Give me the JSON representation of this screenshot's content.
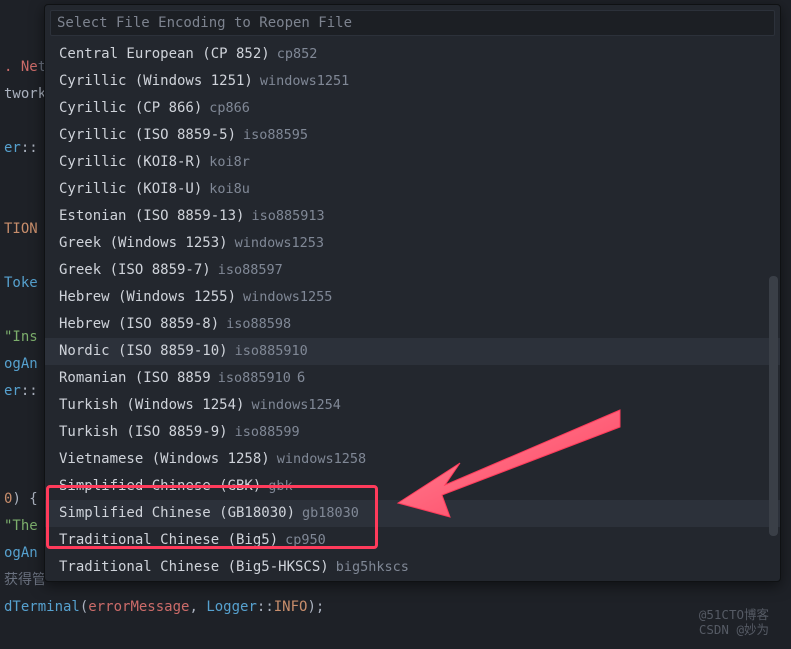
{
  "search": {
    "placeholder": "Select File Encoding to Reopen File"
  },
  "items": [
    {
      "label": "Central European (CP 852)",
      "desc": "cp852",
      "hl": false
    },
    {
      "label": "Cyrillic (Windows 1251)",
      "desc": "windows1251",
      "hl": false
    },
    {
      "label": "Cyrillic (CP 866)",
      "desc": "cp866",
      "hl": false
    },
    {
      "label": "Cyrillic (ISO 8859-5)",
      "desc": "iso88595",
      "hl": false
    },
    {
      "label": "Cyrillic (KOI8-R)",
      "desc": "koi8r",
      "hl": false
    },
    {
      "label": "Cyrillic (KOI8-U)",
      "desc": "koi8u",
      "hl": false
    },
    {
      "label": "Estonian (ISO 8859-13)",
      "desc": "iso885913",
      "hl": false
    },
    {
      "label": "Greek (Windows 1253)",
      "desc": "windows1253",
      "hl": false
    },
    {
      "label": "Greek (ISO 8859-7)",
      "desc": "iso88597",
      "hl": false
    },
    {
      "label": "Hebrew (Windows 1255)",
      "desc": "windows1255",
      "hl": false
    },
    {
      "label": "Hebrew (ISO 8859-8)",
      "desc": "iso88598",
      "hl": false
    },
    {
      "label": "Nordic (ISO 8859-10)",
      "desc": "iso885910",
      "hl": true
    },
    {
      "label": "Romanian (ISO 8859",
      "desc": "iso885910",
      "extra": "6",
      "hl": false
    },
    {
      "label": "Turkish (Windows 1254)",
      "desc": "windows1254",
      "hl": false
    },
    {
      "label": "Turkish (ISO 8859-9)",
      "desc": "iso88599",
      "hl": false
    },
    {
      "label": "Vietnamese (Windows 1258)",
      "desc": "windows1258",
      "hl": false
    },
    {
      "label": "Simplified Chinese (GBK)",
      "desc": "gbk",
      "hl": false
    },
    {
      "label": "Simplified Chinese (GB18030)",
      "desc": "gb18030",
      "hl": true
    },
    {
      "label": "Traditional Chinese (Big5)",
      "desc": "cp950",
      "hl": false
    },
    {
      "label": "Traditional Chinese (Big5-HKSCS)",
      "desc": "big5hkscs",
      "hl": false
    }
  ],
  "bg_code": {
    "l1": "",
    "l2_red": ". Ne",
    "l2_gray": "t",
    "l3": "twork",
    "l4": "",
    "l5_blue": "er",
    "l5_white": "::",
    "l6": "",
    "l7": "",
    "l8_orange": "TION",
    "l9": "",
    "l10_blue": "Toke",
    "l11": "",
    "l12_green": "\"Ins",
    "l13_blue": "ogAn",
    "l14_blue": "er",
    "l14_white": "::",
    "l15": "",
    "l16": "",
    "l17": "",
    "l18_orange": "0",
    "l18_white": ") {",
    "l19_green": "\"The",
    "l20_blue": "ogAn",
    "l21_cjk": "获得管",
    "l22_blue": "dTerminal",
    "l22_white1": "(",
    "l22_red": "errorMessage",
    "l22_white2": ", ",
    "l22_skyblue": "Logger",
    "l22_white3": "::",
    "l22_orange": "INFO",
    "l22_white4": ");"
  },
  "watermark": {
    "line1": "@51CTO博客",
    "line2": "CSDN @妙为"
  }
}
